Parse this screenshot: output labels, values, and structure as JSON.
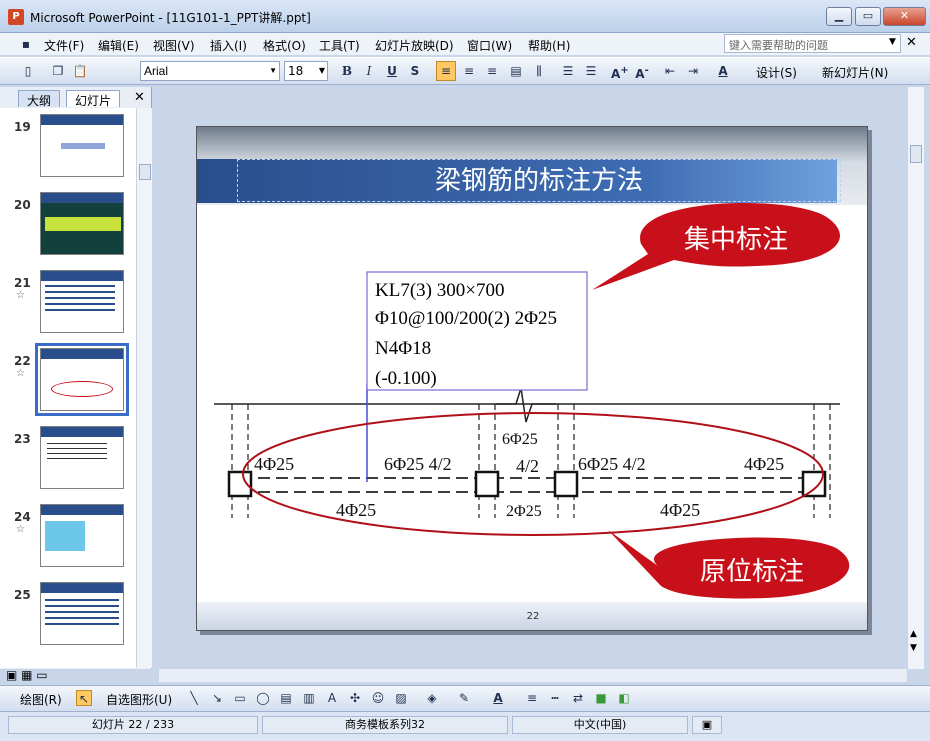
{
  "window": {
    "title": "Microsoft PowerPoint - [11G101-1_PPT讲解.ppt]",
    "app_icon_letter": "P"
  },
  "menu": {
    "items": [
      "文件(F)",
      "编辑(E)",
      "视图(V)",
      "插入(I)",
      "格式(O)",
      "工具(T)",
      "幻灯片放映(D)",
      "窗口(W)",
      "帮助(H)"
    ],
    "help_placeholder": "键入需要帮助的问题"
  },
  "toolbar": {
    "font": "Arial",
    "size": "18",
    "design_label": "设计(S)",
    "new_slide_label": "新幻灯片(N)"
  },
  "panel": {
    "tabs": [
      "大纲",
      "幻灯片"
    ],
    "active_tab": "幻灯片",
    "slides": [
      {
        "num": "19",
        "starred": false
      },
      {
        "num": "20",
        "starred": false
      },
      {
        "num": "21",
        "starred": true
      },
      {
        "num": "22",
        "starred": true,
        "selected": true
      },
      {
        "num": "23",
        "starred": false
      },
      {
        "num": "24",
        "starred": true
      },
      {
        "num": "25",
        "starred": false
      }
    ]
  },
  "slide": {
    "title": "梁钢筋的标注方法",
    "callout_top": "集中标注",
    "callout_bottom": "原位标注",
    "page_number": "22",
    "box_lines": [
      "KL7(3) 300×700",
      "Φ10@100/200(2) 2Φ25",
      "N4Φ18",
      "(-0.100)"
    ],
    "labels": {
      "top_left": "4Φ25",
      "top_mid_left": "6Φ25 4/2",
      "mid_top": "6Φ25",
      "mid_center": "4/2",
      "top_mid_right": "6Φ25 4/2",
      "top_right": "4Φ25",
      "bottom_left": "4Φ25",
      "bottom_mid": "2Φ25",
      "bottom_right": "4Φ25"
    }
  },
  "drawbar": {
    "draw_label": "绘图(R)",
    "autoshape_label": "自选图形(U)"
  },
  "status": {
    "slide_info": "幻灯片 22 / 233",
    "template": "商务模板系列32",
    "language": "中文(中国)"
  },
  "colors": {
    "title_bar": "#2a4e8c",
    "callout": "#c8101a",
    "ellipse": "#b01018",
    "box_border": "#7a6ad0"
  }
}
